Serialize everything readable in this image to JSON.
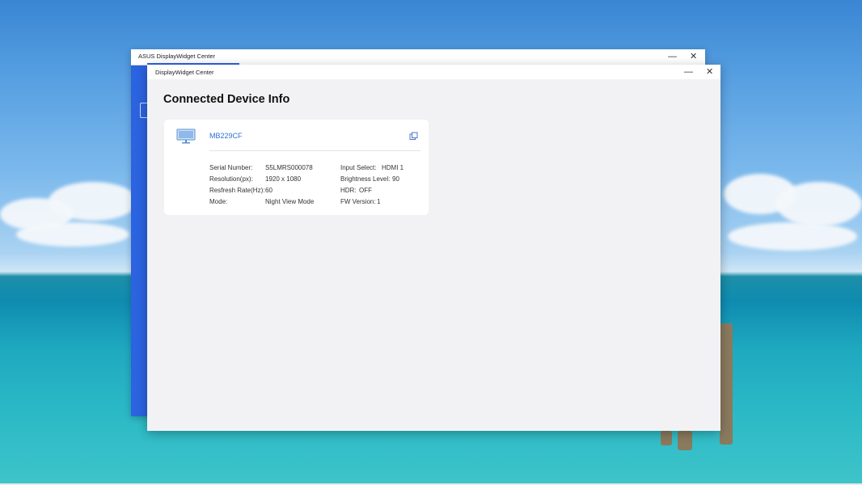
{
  "back_window": {
    "title": "ASUS DisplayWidget Center",
    "minimize_glyph": "—",
    "close_glyph": "✕"
  },
  "front_window": {
    "title": "DisplayWidget Center",
    "minimize_glyph": "—",
    "close_glyph": "✕"
  },
  "page": {
    "title": "Connected Device Info"
  },
  "device": {
    "icon": "monitor-icon",
    "model": "MB229CF",
    "copy_icon": "copy-icon",
    "left_column": [
      {
        "label": "Serial Number:",
        "value": "S5LMRS000078"
      },
      {
        "label": "Resolution(px):",
        "value": "1920 x 1080"
      },
      {
        "label": "Resfresh Rate(Hz):",
        "value": "60"
      },
      {
        "label": "Mode:",
        "value": "Night View Mode"
      }
    ],
    "right_column": [
      {
        "label": "Input Select:",
        "value": "HDMI 1"
      },
      {
        "label": "Brightness Level:",
        "value": "90"
      },
      {
        "label": "HDR:",
        "value": "OFF"
      },
      {
        "label": "FW Version:",
        "value": "1"
      }
    ]
  },
  "colors": {
    "accent_blue": "#2b63e0",
    "link_blue": "#2e6fd6",
    "content_bg": "#f2f2f4"
  }
}
